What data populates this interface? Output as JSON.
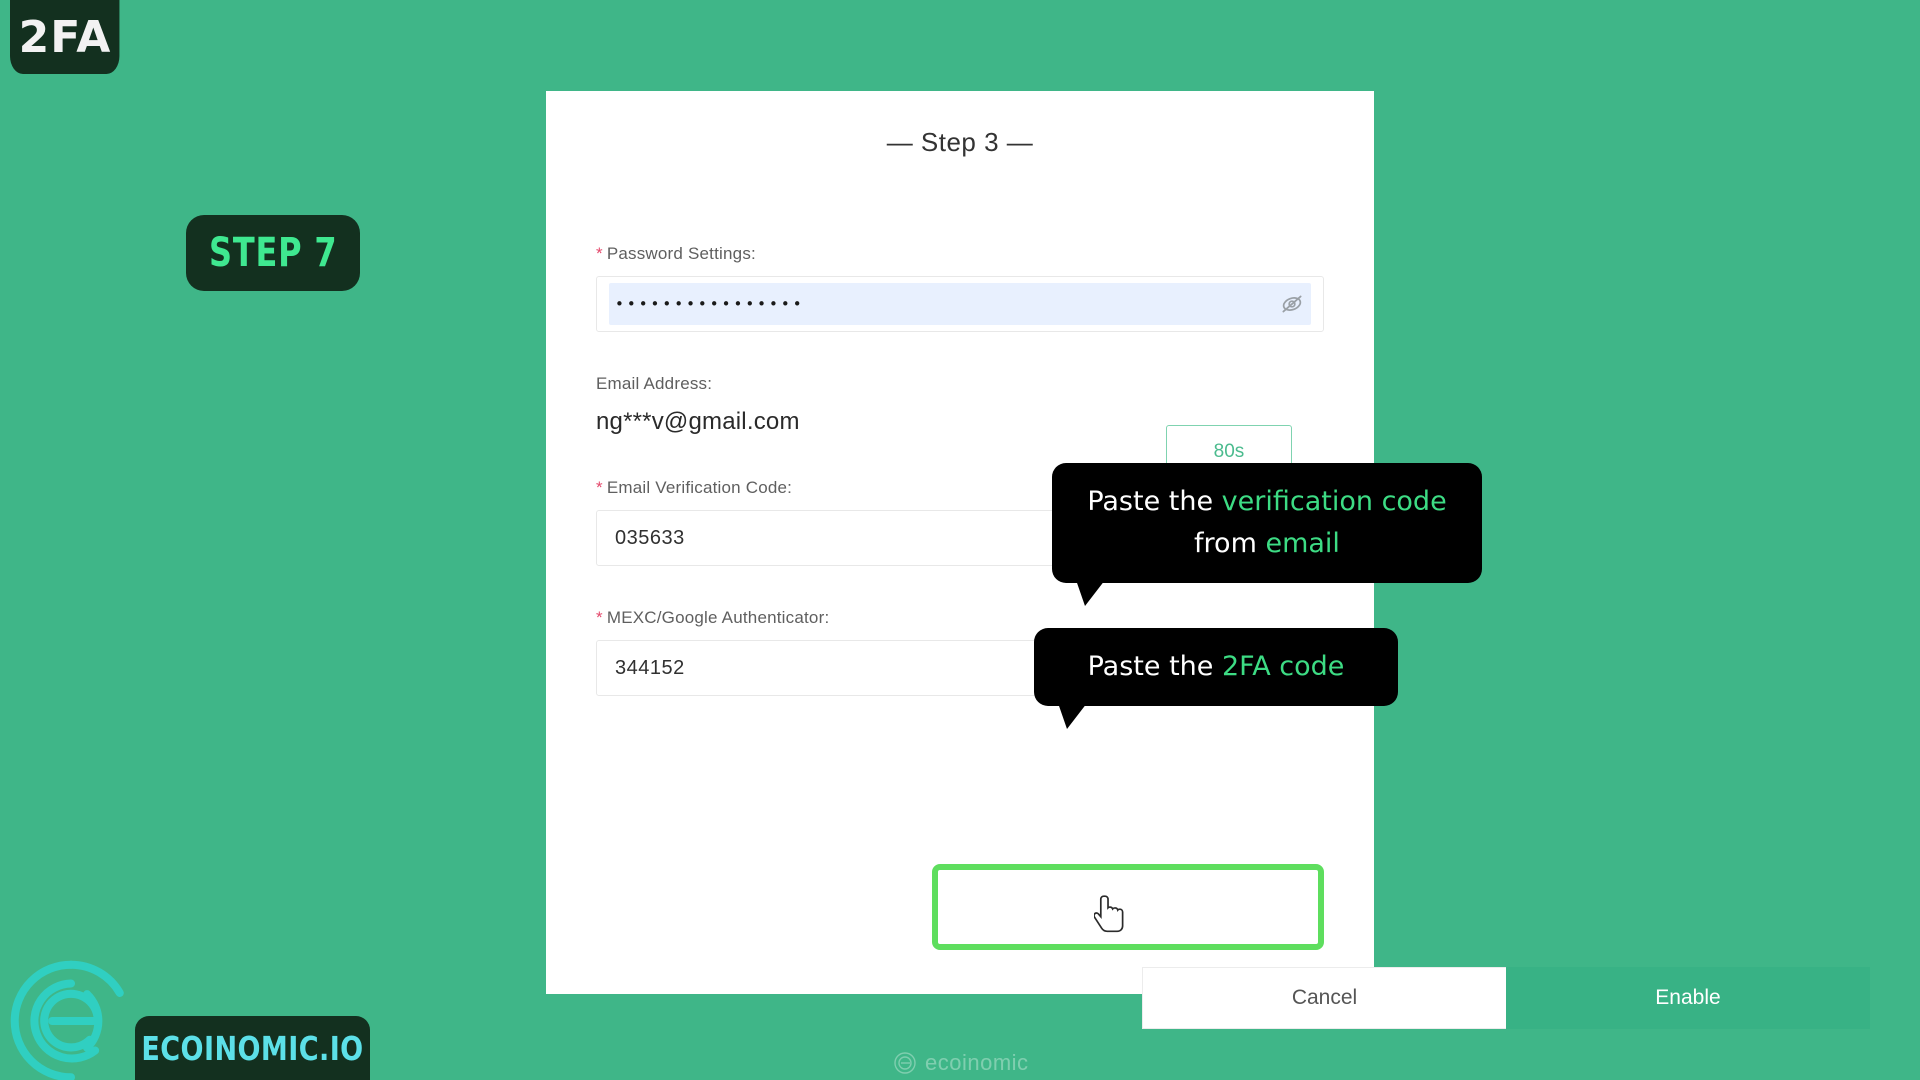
{
  "overlay": {
    "topic_badge": "2FA",
    "step_badge": "STEP 7",
    "brand_badge": "ECOINOMIC.IO",
    "watermark": "ecoinomic"
  },
  "card": {
    "title": "— Step 3 —",
    "required_marker": "*",
    "password": {
      "label": "Password Settings:",
      "value": "••••••••••••••••",
      "toggle_icon": "eye-off-icon"
    },
    "email": {
      "label": "Email Address:",
      "value": "ng***v@gmail.com"
    },
    "timer": {
      "label": "80s"
    },
    "email_code": {
      "label": "Email Verification Code:",
      "value": "035633",
      "placeholder": ""
    },
    "authenticator": {
      "label": "MEXC/Google Authenticator:",
      "value": "344152",
      "placeholder": ""
    },
    "actions": {
      "cancel_label": "Cancel",
      "enable_label": "Enable"
    }
  },
  "tooltips": {
    "email_code": {
      "line1_plain": "Paste the ",
      "line1_highlight": "verification code",
      "line2_plain": "from ",
      "line2_highlight": "email"
    },
    "authenticator": {
      "plain": "Paste the ",
      "highlight": "2FA code"
    }
  },
  "colors": {
    "background_green": "#3fb688",
    "badge_dark": "#13301f",
    "accent_green": "#3fe890",
    "tooltip_accent": "#3ddc84",
    "highlight_border": "#5ede5e",
    "enable_button": "#38b285",
    "brand_cyan": "#5ce0e8"
  }
}
